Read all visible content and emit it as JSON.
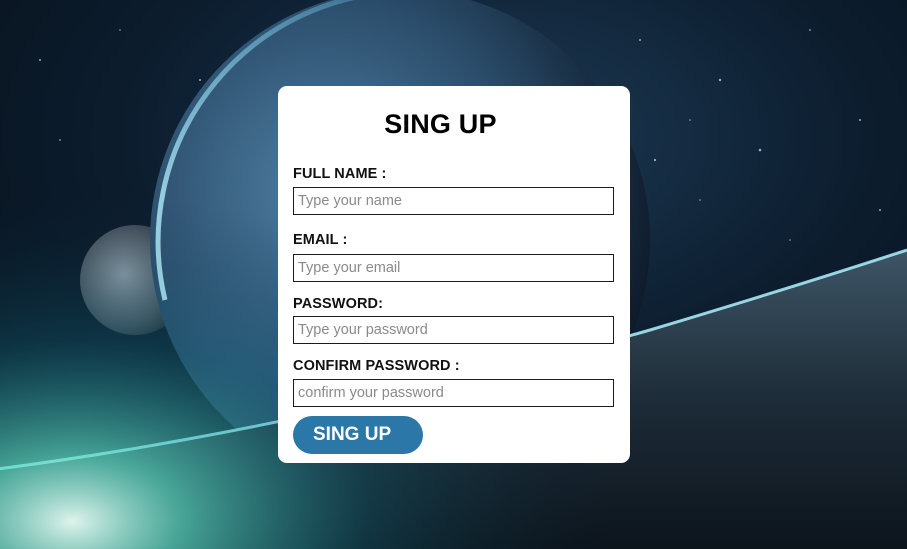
{
  "form": {
    "title": "SING UP",
    "fields": [
      {
        "label": "FULL NAME :",
        "placeholder": "Type your name",
        "type": "text"
      },
      {
        "label": "EMAIL :",
        "placeholder": "Type your email",
        "type": "email"
      },
      {
        "label": "PASSWORD:",
        "placeholder": "Type your password",
        "type": "password"
      },
      {
        "label": "CONFIRM PASSWORD :",
        "placeholder": "confirm your password",
        "type": "password"
      }
    ],
    "submit_label": "SING UP"
  },
  "colors": {
    "button": "#2b78a8",
    "card": "#ffffff",
    "space_bg": "#0a1a2a"
  }
}
